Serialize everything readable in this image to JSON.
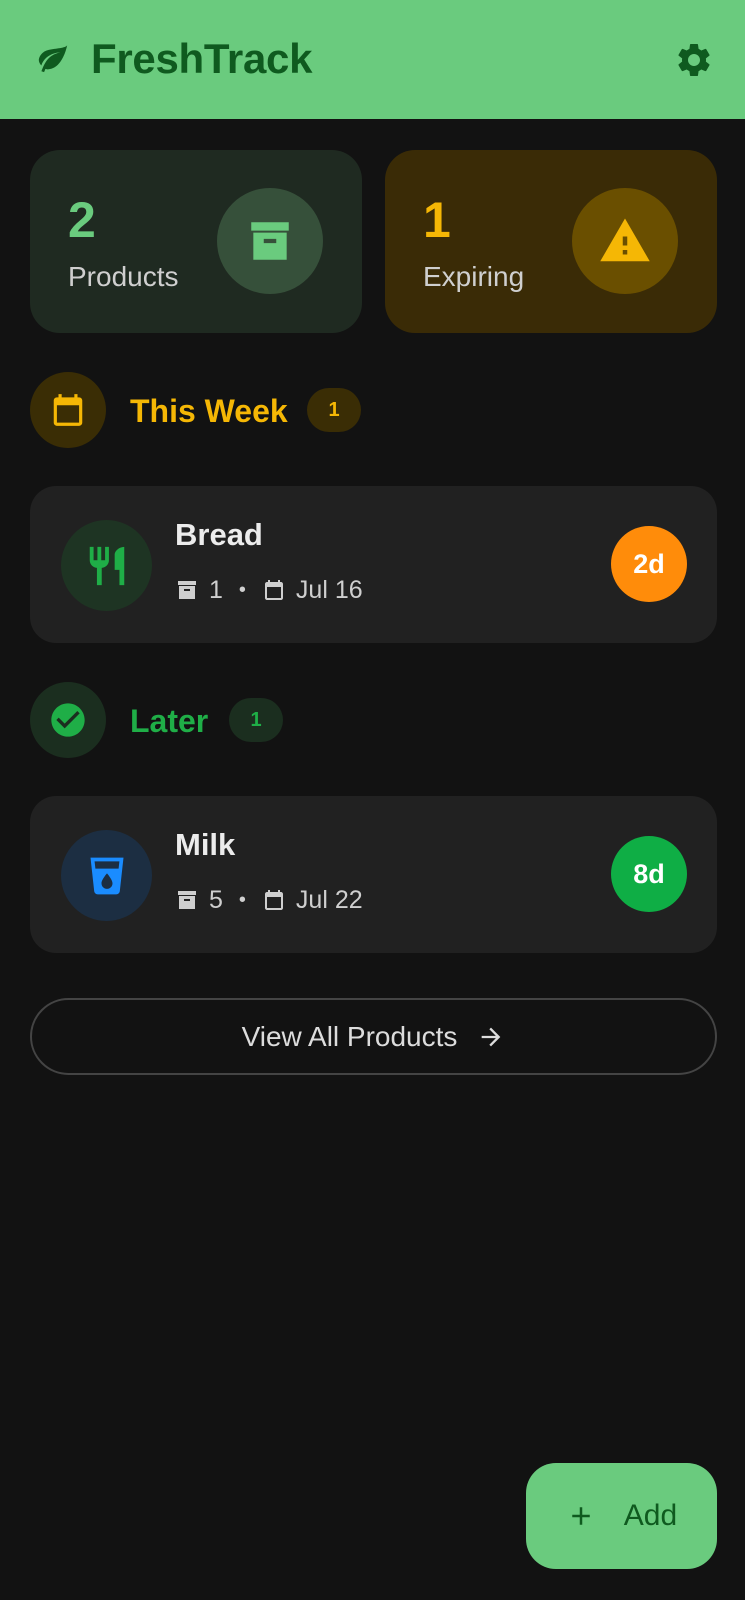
{
  "app": {
    "title": "FreshTrack",
    "logo_icon": "leaf-icon",
    "settings_icon": "gear-icon"
  },
  "stats": [
    {
      "value": "2",
      "label": "Products",
      "icon": "archive-box-icon",
      "color": "#6acb7e"
    },
    {
      "value": "1",
      "label": "Expiring",
      "icon": "warning-icon",
      "color": "#f5b705"
    }
  ],
  "sections": [
    {
      "title": "This Week",
      "count": "1",
      "icon": "calendar-icon",
      "color": "#f5b705",
      "items": [
        {
          "name": "Bread",
          "quantity": "1",
          "date": "Jul 16",
          "days_left": "2d",
          "icon": "utensils-icon",
          "badge_color": "#ff8c0a"
        }
      ]
    },
    {
      "title": "Later",
      "count": "1",
      "icon": "check-circle-icon",
      "color": "#1fae47",
      "items": [
        {
          "name": "Milk",
          "quantity": "5",
          "date": "Jul 22",
          "days_left": "8d",
          "icon": "water-glass-icon",
          "badge_color": "#0fae45"
        }
      ]
    }
  ],
  "view_all": {
    "label": "View All Products",
    "icon": "arrow-right-icon"
  },
  "fab": {
    "label": "Add",
    "icon": "plus-icon"
  }
}
